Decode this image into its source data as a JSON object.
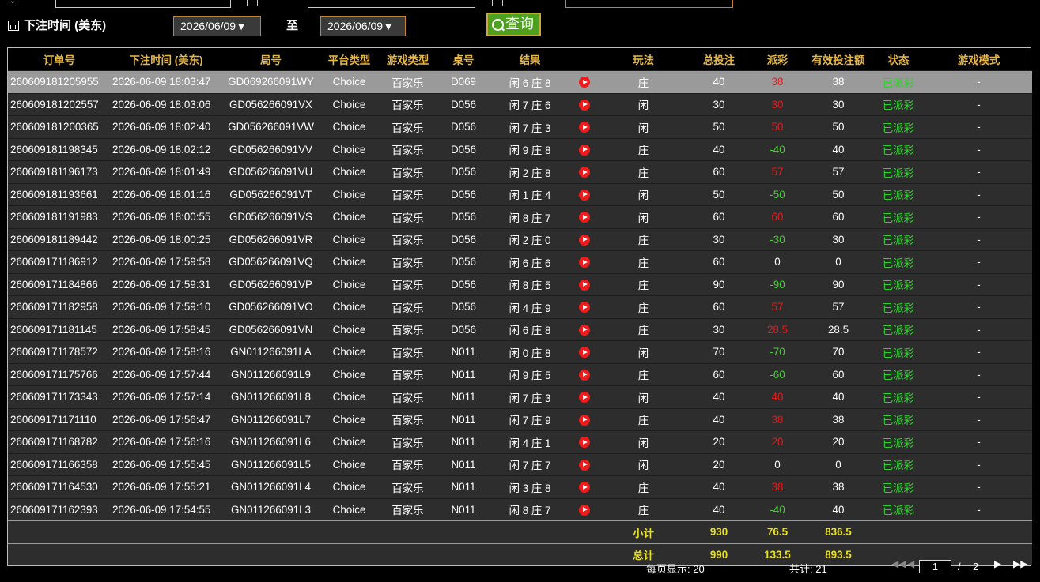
{
  "filter": {
    "label": "下注时间 (美东)",
    "date_from": "2026/06/09▼",
    "to_label": "至",
    "date_to": "2026/06/09▼",
    "search_label": "查询"
  },
  "table": {
    "headers": [
      "订单号",
      "下注时间 (美东)",
      "局号",
      "平台类型",
      "游戏类型",
      "桌号",
      "结果",
      "",
      "玩法",
      "总投注",
      "派彩",
      "有效投注额",
      "状态",
      "游戏模式"
    ],
    "rows": [
      {
        "order": "260609181205955",
        "time": "2026-06-09 18:03:47",
        "round": "GD069266091WY",
        "platform": "Choice",
        "game": "百家乐",
        "table": "D069",
        "result": "闲 6 庄 8",
        "play": "庄",
        "bet": "40",
        "payout": "38",
        "payout_sign": "pos",
        "valid": "38",
        "status": "已派彩",
        "mode": "-"
      },
      {
        "order": "260609181202557",
        "time": "2026-06-09 18:03:06",
        "round": "GD056266091VX",
        "platform": "Choice",
        "game": "百家乐",
        "table": "D056",
        "result": "闲 7 庄 6",
        "play": "闲",
        "bet": "30",
        "payout": "30",
        "payout_sign": "pos",
        "valid": "30",
        "status": "已派彩",
        "mode": "-"
      },
      {
        "order": "260609181200365",
        "time": "2026-06-09 18:02:40",
        "round": "GD056266091VW",
        "platform": "Choice",
        "game": "百家乐",
        "table": "D056",
        "result": "闲 7 庄 3",
        "play": "闲",
        "bet": "50",
        "payout": "50",
        "payout_sign": "pos",
        "valid": "50",
        "status": "已派彩",
        "mode": "-"
      },
      {
        "order": "260609181198345",
        "time": "2026-06-09 18:02:12",
        "round": "GD056266091VV",
        "platform": "Choice",
        "game": "百家乐",
        "table": "D056",
        "result": "闲 9 庄 8",
        "play": "庄",
        "bet": "40",
        "payout": "-40",
        "payout_sign": "neg",
        "valid": "40",
        "status": "已派彩",
        "mode": "-"
      },
      {
        "order": "260609181196173",
        "time": "2026-06-09 18:01:49",
        "round": "GD056266091VU",
        "platform": "Choice",
        "game": "百家乐",
        "table": "D056",
        "result": "闲 2 庄 8",
        "play": "庄",
        "bet": "60",
        "payout": "57",
        "payout_sign": "pos",
        "valid": "57",
        "status": "已派彩",
        "mode": "-"
      },
      {
        "order": "260609181193661",
        "time": "2026-06-09 18:01:16",
        "round": "GD056266091VT",
        "platform": "Choice",
        "game": "百家乐",
        "table": "D056",
        "result": "闲 1 庄 4",
        "play": "闲",
        "bet": "50",
        "payout": "-50",
        "payout_sign": "neg",
        "valid": "50",
        "status": "已派彩",
        "mode": "-"
      },
      {
        "order": "260609181191983",
        "time": "2026-06-09 18:00:55",
        "round": "GD056266091VS",
        "platform": "Choice",
        "game": "百家乐",
        "table": "D056",
        "result": "闲 8 庄 7",
        "play": "闲",
        "bet": "60",
        "payout": "60",
        "payout_sign": "pos",
        "valid": "60",
        "status": "已派彩",
        "mode": "-"
      },
      {
        "order": "260609181189442",
        "time": "2026-06-09 18:00:25",
        "round": "GD056266091VR",
        "platform": "Choice",
        "game": "百家乐",
        "table": "D056",
        "result": "闲 2 庄 0",
        "play": "庄",
        "bet": "30",
        "payout": "-30",
        "payout_sign": "neg",
        "valid": "30",
        "status": "已派彩",
        "mode": "-"
      },
      {
        "order": "260609171186912",
        "time": "2026-06-09 17:59:58",
        "round": "GD056266091VQ",
        "platform": "Choice",
        "game": "百家乐",
        "table": "D056",
        "result": "闲 6 庄 6",
        "play": "庄",
        "bet": "60",
        "payout": "0",
        "payout_sign": "zero",
        "valid": "0",
        "status": "已派彩",
        "mode": "-"
      },
      {
        "order": "260609171184866",
        "time": "2026-06-09 17:59:31",
        "round": "GD056266091VP",
        "platform": "Choice",
        "game": "百家乐",
        "table": "D056",
        "result": "闲 8 庄 5",
        "play": "庄",
        "bet": "90",
        "payout": "-90",
        "payout_sign": "neg",
        "valid": "90",
        "status": "已派彩",
        "mode": "-"
      },
      {
        "order": "260609171182958",
        "time": "2026-06-09 17:59:10",
        "round": "GD056266091VO",
        "platform": "Choice",
        "game": "百家乐",
        "table": "D056",
        "result": "闲 4 庄 9",
        "play": "庄",
        "bet": "60",
        "payout": "57",
        "payout_sign": "pos",
        "valid": "57",
        "status": "已派彩",
        "mode": "-"
      },
      {
        "order": "260609171181145",
        "time": "2026-06-09 17:58:45",
        "round": "GD056266091VN",
        "platform": "Choice",
        "game": "百家乐",
        "table": "D056",
        "result": "闲 6 庄 8",
        "play": "庄",
        "bet": "30",
        "payout": "28.5",
        "payout_sign": "pos",
        "valid": "28.5",
        "status": "已派彩",
        "mode": "-"
      },
      {
        "order": "260609171178572",
        "time": "2026-06-09 17:58:16",
        "round": "GN011266091LA",
        "platform": "Choice",
        "game": "百家乐",
        "table": "N011",
        "result": "闲 0 庄 8",
        "play": "闲",
        "bet": "70",
        "payout": "-70",
        "payout_sign": "neg",
        "valid": "70",
        "status": "已派彩",
        "mode": "-"
      },
      {
        "order": "260609171175766",
        "time": "2026-06-09 17:57:44",
        "round": "GN011266091L9",
        "platform": "Choice",
        "game": "百家乐",
        "table": "N011",
        "result": "闲 9 庄 5",
        "play": "庄",
        "bet": "60",
        "payout": "-60",
        "payout_sign": "neg",
        "valid": "60",
        "status": "已派彩",
        "mode": "-"
      },
      {
        "order": "260609171173343",
        "time": "2026-06-09 17:57:14",
        "round": "GN011266091L8",
        "platform": "Choice",
        "game": "百家乐",
        "table": "N011",
        "result": "闲 7 庄 3",
        "play": "闲",
        "bet": "40",
        "payout": "40",
        "payout_sign": "pos",
        "valid": "40",
        "status": "已派彩",
        "mode": "-"
      },
      {
        "order": "260609171171110",
        "time": "2026-06-09 17:56:47",
        "round": "GN011266091L7",
        "platform": "Choice",
        "game": "百家乐",
        "table": "N011",
        "result": "闲 7 庄 9",
        "play": "庄",
        "bet": "40",
        "payout": "38",
        "payout_sign": "pos",
        "valid": "38",
        "status": "已派彩",
        "mode": "-"
      },
      {
        "order": "260609171168782",
        "time": "2026-06-09 17:56:16",
        "round": "GN011266091L6",
        "platform": "Choice",
        "game": "百家乐",
        "table": "N011",
        "result": "闲 4 庄 1",
        "play": "闲",
        "bet": "20",
        "payout": "20",
        "payout_sign": "pos",
        "valid": "20",
        "status": "已派彩",
        "mode": "-"
      },
      {
        "order": "260609171166358",
        "time": "2026-06-09 17:55:45",
        "round": "GN011266091L5",
        "platform": "Choice",
        "game": "百家乐",
        "table": "N011",
        "result": "闲 7 庄 7",
        "play": "闲",
        "bet": "20",
        "payout": "0",
        "payout_sign": "zero",
        "valid": "0",
        "status": "已派彩",
        "mode": "-"
      },
      {
        "order": "260609171164530",
        "time": "2026-06-09 17:55:21",
        "round": "GN011266091L4",
        "platform": "Choice",
        "game": "百家乐",
        "table": "N011",
        "result": "闲 3 庄 8",
        "play": "庄",
        "bet": "40",
        "payout": "38",
        "payout_sign": "pos",
        "valid": "38",
        "status": "已派彩",
        "mode": "-"
      },
      {
        "order": "260609171162393",
        "time": "2026-06-09 17:54:55",
        "round": "GN011266091L3",
        "platform": "Choice",
        "game": "百家乐",
        "table": "N011",
        "result": "闲 8 庄 7",
        "play": "庄",
        "bet": "40",
        "payout": "-40",
        "payout_sign": "neg",
        "valid": "40",
        "status": "已派彩",
        "mode": "-"
      }
    ],
    "selected_row": 0,
    "subtotal": {
      "label": "小计",
      "bet": "930",
      "payout": "76.5",
      "valid": "836.5"
    },
    "total": {
      "label": "总计",
      "bet": "990",
      "payout": "133.5",
      "valid": "893.5"
    }
  },
  "footer": {
    "per_page": "每页显示: 20",
    "total_count": "共计: 21",
    "first_icon": "first-page-icon",
    "prev_icon": "prev-page-icon",
    "page_value": "1",
    "slash": "/",
    "total_pages": "2",
    "next_icon": "next-page-icon",
    "last_icon": "last-page-icon"
  },
  "colors": {
    "header_text": "#e6b84a",
    "positive": "#e81919",
    "negative": "#45d030",
    "status": "#2bd22b",
    "summary": "#e8e028",
    "accent_border": "#c8822e",
    "search_button": "#4ea11f"
  }
}
